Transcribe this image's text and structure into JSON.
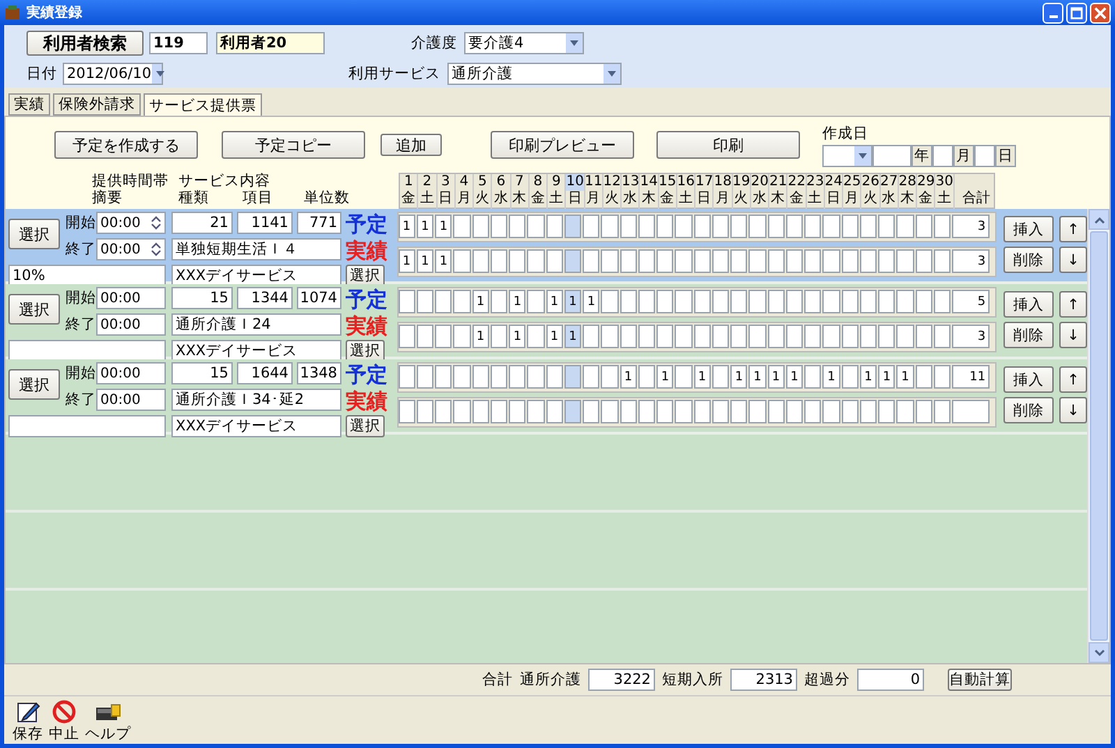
{
  "window": {
    "title": "実績登録"
  },
  "header": {
    "search_button": "利用者検索",
    "user_id": "119",
    "user_name": "利用者20",
    "date_label": "日付",
    "date": "2012/06/10",
    "care_level_label": "介護度",
    "care_level": "要介護4",
    "service_label": "利用サービス",
    "service": "通所介護"
  },
  "tabs": [
    {
      "label": "実績",
      "selected": false
    },
    {
      "label": "保険外請求",
      "selected": false
    },
    {
      "label": "サービス提供票",
      "selected": true
    }
  ],
  "toolbar": {
    "buttons": [
      "予定を作成する",
      "予定コピー",
      "追加",
      "印刷プレビュー",
      "印刷"
    ],
    "created_date_label": "作成日",
    "year_label": "年",
    "month_label": "月",
    "day_label": "日"
  },
  "columns": {
    "time_slot": "提供時間帯",
    "memo": "摘要",
    "service_content": "サービス内容",
    "type": "種類",
    "item": "項目",
    "units": "単位数",
    "total": "合計"
  },
  "days": [
    {
      "date": "1",
      "weekday": "金",
      "selected": false
    },
    {
      "date": "2",
      "weekday": "土",
      "selected": false
    },
    {
      "date": "3",
      "weekday": "日",
      "selected": false
    },
    {
      "date": "4",
      "weekday": "月",
      "selected": false
    },
    {
      "date": "5",
      "weekday": "火",
      "selected": false
    },
    {
      "date": "6",
      "weekday": "水",
      "selected": false
    },
    {
      "date": "7",
      "weekday": "木",
      "selected": false
    },
    {
      "date": "8",
      "weekday": "金",
      "selected": false
    },
    {
      "date": "9",
      "weekday": "土",
      "selected": false
    },
    {
      "date": "10",
      "weekday": "日",
      "selected": true
    },
    {
      "date": "11",
      "weekday": "月",
      "selected": false
    },
    {
      "date": "12",
      "weekday": "火",
      "selected": false
    },
    {
      "date": "13",
      "weekday": "水",
      "selected": false
    },
    {
      "date": "14",
      "weekday": "木",
      "selected": false
    },
    {
      "date": "15",
      "weekday": "金",
      "selected": false
    },
    {
      "date": "16",
      "weekday": "土",
      "selected": false
    },
    {
      "date": "17",
      "weekday": "日",
      "selected": false
    },
    {
      "date": "18",
      "weekday": "月",
      "selected": false
    },
    {
      "date": "19",
      "weekday": "火",
      "selected": false
    },
    {
      "date": "20",
      "weekday": "水",
      "selected": false
    },
    {
      "date": "21",
      "weekday": "木",
      "selected": false
    },
    {
      "date": "22",
      "weekday": "金",
      "selected": false
    },
    {
      "date": "23",
      "weekday": "土",
      "selected": false
    },
    {
      "date": "24",
      "weekday": "日",
      "selected": false
    },
    {
      "date": "25",
      "weekday": "月",
      "selected": false
    },
    {
      "date": "26",
      "weekday": "火",
      "selected": false
    },
    {
      "date": "27",
      "weekday": "水",
      "selected": false
    },
    {
      "date": "28",
      "weekday": "木",
      "selected": false
    },
    {
      "date": "29",
      "weekday": "金",
      "selected": false
    },
    {
      "date": "30",
      "weekday": "土",
      "selected": false
    }
  ],
  "rows": [
    {
      "selected": true,
      "select_button": "選択",
      "start_label": "開始",
      "start": "00:00",
      "end_label": "終了",
      "end": "00:00",
      "memo": "10%",
      "type": "21",
      "item": "1141",
      "units": "771",
      "service_name": "単独短期生活Ｉ４",
      "provider": "XXXデイサービス",
      "provider_button": "選択",
      "plan_label": "予定",
      "plan": [
        {
          "kind": "entry",
          "value": "1"
        },
        {
          "kind": "entry",
          "value": "1"
        },
        {
          "kind": "entry",
          "value": "1"
        },
        {
          "kind": "blank"
        },
        {
          "kind": "blank"
        },
        {
          "kind": "blank"
        },
        {
          "kind": "blank"
        },
        {
          "kind": "blank"
        },
        {
          "kind": "blank"
        },
        {
          "kind": "blank"
        },
        {
          "kind": "blank"
        },
        {
          "kind": "blank"
        },
        {
          "kind": "blank"
        },
        {
          "kind": "blank"
        },
        {
          "kind": "blank"
        },
        {
          "kind": "blank"
        },
        {
          "kind": "blank"
        },
        {
          "kind": "blank"
        },
        {
          "kind": "blank"
        },
        {
          "kind": "blank"
        },
        {
          "kind": "blank"
        },
        {
          "kind": "blank"
        },
        {
          "kind": "blank"
        },
        {
          "kind": "blank"
        },
        {
          "kind": "blank"
        },
        {
          "kind": "blank"
        },
        {
          "kind": "blank"
        },
        {
          "kind": "blank"
        },
        {
          "kind": "blank"
        },
        {
          "kind": "blank"
        }
      ],
      "plan_total": "3",
      "actual_label": "実績",
      "actual": [
        {
          "kind": "entry",
          "value": "1"
        },
        {
          "kind": "entry",
          "value": "1"
        },
        {
          "kind": "entry",
          "value": "1"
        },
        {
          "kind": "blank"
        },
        {
          "kind": "blank"
        },
        {
          "kind": "blank"
        },
        {
          "kind": "blank"
        },
        {
          "kind": "blank"
        },
        {
          "kind": "blank"
        },
        {
          "kind": "blank"
        },
        {
          "kind": "blank"
        },
        {
          "kind": "blank"
        },
        {
          "kind": "blank"
        },
        {
          "kind": "blank"
        },
        {
          "kind": "blank"
        },
        {
          "kind": "blank"
        },
        {
          "kind": "blank"
        },
        {
          "kind": "blank"
        },
        {
          "kind": "blank"
        },
        {
          "kind": "blank"
        },
        {
          "kind": "blank"
        },
        {
          "kind": "blank"
        },
        {
          "kind": "blank"
        },
        {
          "kind": "blank"
        },
        {
          "kind": "blank"
        },
        {
          "kind": "blank"
        },
        {
          "kind": "blank"
        },
        {
          "kind": "blank"
        },
        {
          "kind": "blank"
        },
        {
          "kind": "blank"
        }
      ],
      "actual_total": "3",
      "insert_button": "挿入",
      "delete_button": "削除",
      "up_button": "↑",
      "down_button": "↓"
    },
    {
      "selected": false,
      "select_button": "選択",
      "start_label": "開始",
      "start": "00:00",
      "end_label": "終了",
      "end": "00:00",
      "type": "15",
      "item": "1344",
      "units": "1074",
      "service_name": "通所介護Ｉ24",
      "provider": "XXXデイサービス",
      "provider_button": "選択",
      "plan_label": "予定",
      "plan": [
        {
          "kind": "blank"
        },
        {
          "kind": "blank"
        },
        {
          "kind": "blank"
        },
        {
          "kind": "blank"
        },
        {
          "kind": "entry",
          "value": "1"
        },
        {
          "kind": "blank"
        },
        {
          "kind": "entry",
          "value": "1"
        },
        {
          "kind": "blank"
        },
        {
          "kind": "entry",
          "value": "1"
        },
        {
          "kind": "entry",
          "value": "1"
        },
        {
          "kind": "entry",
          "value": "1"
        },
        {
          "kind": "blank"
        },
        {
          "kind": "blank"
        },
        {
          "kind": "blank"
        },
        {
          "kind": "blank"
        },
        {
          "kind": "blank"
        },
        {
          "kind": "blank"
        },
        {
          "kind": "blank"
        },
        {
          "kind": "blank"
        },
        {
          "kind": "blank"
        },
        {
          "kind": "blank"
        },
        {
          "kind": "blank"
        },
        {
          "kind": "blank"
        },
        {
          "kind": "blank"
        },
        {
          "kind": "blank"
        },
        {
          "kind": "blank"
        },
        {
          "kind": "blank"
        },
        {
          "kind": "blank"
        },
        {
          "kind": "blank"
        },
        {
          "kind": "blank"
        }
      ],
      "plan_total": "5",
      "actual_label": "実績",
      "actual": [
        {
          "kind": "blank"
        },
        {
          "kind": "blank"
        },
        {
          "kind": "blank"
        },
        {
          "kind": "blank"
        },
        {
          "kind": "entry",
          "value": "1"
        },
        {
          "kind": "blank"
        },
        {
          "kind": "entry",
          "value": "1"
        },
        {
          "kind": "blank"
        },
        {
          "kind": "entry",
          "value": "1"
        },
        {
          "kind": "entry",
          "value": "1"
        },
        {
          "kind": "blank"
        },
        {
          "kind": "blank"
        },
        {
          "kind": "blank"
        },
        {
          "kind": "blank"
        },
        {
          "kind": "blank"
        },
        {
          "kind": "blank"
        },
        {
          "kind": "blank"
        },
        {
          "kind": "blank"
        },
        {
          "kind": "blank"
        },
        {
          "kind": "blank"
        },
        {
          "kind": "blank"
        },
        {
          "kind": "blank"
        },
        {
          "kind": "blank"
        },
        {
          "kind": "blank"
        },
        {
          "kind": "blank"
        },
        {
          "kind": "blank"
        },
        {
          "kind": "blank"
        },
        {
          "kind": "blank"
        },
        {
          "kind": "blank"
        },
        {
          "kind": "blank"
        }
      ],
      "actual_total": "3",
      "insert_button": "挿入",
      "delete_button": "削除",
      "up_button": "↑",
      "down_button": "↓"
    },
    {
      "selected": false,
      "select_button": "選択",
      "start_label": "開始",
      "start": "00:00",
      "end_label": "終了",
      "end": "00:00",
      "type": "15",
      "item": "1644",
      "units": "1348",
      "service_name": "通所介護Ｉ34･延2",
      "provider": "XXXデイサービス",
      "provider_button": "選択",
      "plan_label": "予定",
      "plan": [
        {
          "kind": "blank"
        },
        {
          "kind": "blank"
        },
        {
          "kind": "blank"
        },
        {
          "kind": "blank"
        },
        {
          "kind": "blank"
        },
        {
          "kind": "blank"
        },
        {
          "kind": "blank"
        },
        {
          "kind": "blank"
        },
        {
          "kind": "blank"
        },
        {
          "kind": "blank"
        },
        {
          "kind": "blank"
        },
        {
          "kind": "blank"
        },
        {
          "kind": "entry",
          "value": "1"
        },
        {
          "kind": "blank"
        },
        {
          "kind": "entry",
          "value": "1"
        },
        {
          "kind": "blank"
        },
        {
          "kind": "entry",
          "value": "1"
        },
        {
          "kind": "blank"
        },
        {
          "kind": "entry",
          "value": "1"
        },
        {
          "kind": "entry",
          "value": "1"
        },
        {
          "kind": "entry",
          "value": "1"
        },
        {
          "kind": "entry",
          "value": "1"
        },
        {
          "kind": "blank"
        },
        {
          "kind": "entry",
          "value": "1"
        },
        {
          "kind": "blank"
        },
        {
          "kind": "entry",
          "value": "1"
        },
        {
          "kind": "entry",
          "value": "1"
        },
        {
          "kind": "entry",
          "value": "1"
        },
        {
          "kind": "blank"
        },
        {
          "kind": "blank"
        }
      ],
      "plan_total": "11",
      "actual_label": "実績",
      "actual": [
        {
          "kind": "blank"
        },
        {
          "kind": "blank"
        },
        {
          "kind": "blank"
        },
        {
          "kind": "blank"
        },
        {
          "kind": "blank"
        },
        {
          "kind": "blank"
        },
        {
          "kind": "blank"
        },
        {
          "kind": "blank"
        },
        {
          "kind": "blank"
        },
        {
          "kind": "blank"
        },
        {
          "kind": "blank"
        },
        {
          "kind": "blank"
        },
        {
          "kind": "blank"
        },
        {
          "kind": "blank"
        },
        {
          "kind": "blank"
        },
        {
          "kind": "blank"
        },
        {
          "kind": "blank"
        },
        {
          "kind": "blank"
        },
        {
          "kind": "blank"
        },
        {
          "kind": "blank"
        },
        {
          "kind": "blank"
        },
        {
          "kind": "blank"
        },
        {
          "kind": "blank"
        },
        {
          "kind": "blank"
        },
        {
          "kind": "blank"
        },
        {
          "kind": "blank"
        },
        {
          "kind": "blank"
        },
        {
          "kind": "blank"
        },
        {
          "kind": "blank"
        },
        {
          "kind": "blank"
        }
      ],
      "insert_button": "挿入",
      "delete_button": "削除",
      "up_button": "↑",
      "down_button": "↓"
    }
  ],
  "totals": {
    "label": "合計",
    "day_service_label": "通所介護",
    "day_service": "3222",
    "short_stay_label": "短期入所",
    "short_stay": "2313",
    "excess_label": "超過分",
    "excess": "0",
    "auto_button": "自動計算"
  },
  "footer": [
    {
      "kind": "save",
      "label": "保存"
    },
    {
      "kind": "cancel",
      "label": "中止"
    },
    {
      "kind": "help",
      "label": "ヘルプ"
    }
  ]
}
